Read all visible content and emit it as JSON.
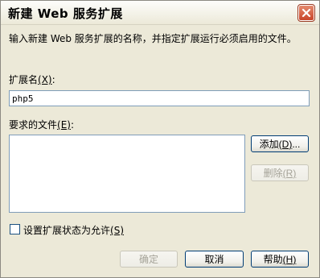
{
  "dialog": {
    "title": "新建 Web 服务扩展",
    "description": "输入新建 Web 服务扩展的名称，并指定扩展运行必须启用的文件。"
  },
  "extension_name": {
    "label": "扩展名",
    "mnemonic": "(X)",
    "suffix": ":",
    "value": "php5"
  },
  "required_files": {
    "label": "要求的文件",
    "mnemonic": "(E)",
    "suffix": ":",
    "items": []
  },
  "buttons": {
    "add": {
      "label": "添加",
      "mnemonic": "(D)",
      "suffix": "..."
    },
    "remove": {
      "label": "删除",
      "mnemonic": "(R)"
    },
    "ok": {
      "label": "确定"
    },
    "cancel": {
      "label": "取消"
    },
    "help": {
      "label": "帮助",
      "mnemonic": "(H)"
    }
  },
  "allow_checkbox": {
    "label": "设置扩展状态为允许",
    "mnemonic": "(S)",
    "checked": false
  }
}
